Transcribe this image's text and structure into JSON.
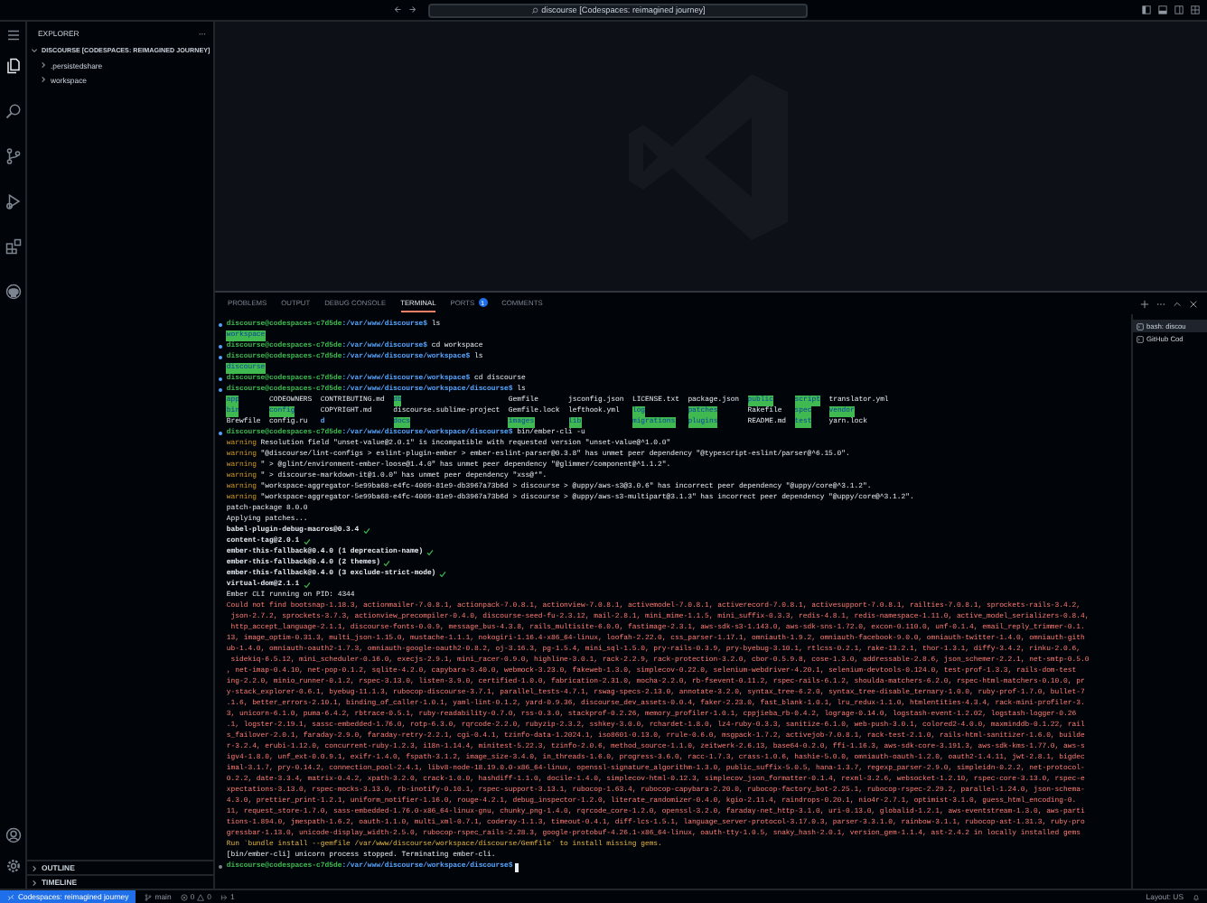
{
  "title_bar": {
    "title": "discourse [Codespaces: reimagined journey]"
  },
  "activity_bar": {
    "items": [
      {
        "selected": true
      },
      {
        "selected": false
      },
      {
        "selected": false
      },
      {
        "selected": false
      },
      {
        "selected": false
      },
      {
        "selected": false
      }
    ]
  },
  "sidebar": {
    "title": "EXPLORER",
    "more": "···",
    "tree": {
      "label": "DISCOURSE [CODESPACES: REIMAGINED JOURNEY]",
      "expanded": true,
      "children": [
        {
          "label": ".persistedshare",
          "expanded": false
        },
        {
          "label": "workspace",
          "expanded": false
        }
      ]
    },
    "sections": [
      {
        "label": "OUTLINE",
        "expanded": false
      },
      {
        "label": "TIMELINE",
        "expanded": false
      }
    ]
  },
  "panel": {
    "tabs": [
      {
        "label": "PROBLEMS",
        "selected": false
      },
      {
        "label": "OUTPUT",
        "selected": false
      },
      {
        "label": "DEBUG CONSOLE",
        "selected": false
      },
      {
        "label": "TERMINAL",
        "selected": true
      },
      {
        "label": "PORTS",
        "selected": false,
        "badge": "1"
      },
      {
        "label": "COMMENTS",
        "selected": false
      }
    ],
    "terminals": [
      {
        "label": "bash: discou",
        "selected": true
      },
      {
        "label": "GitHub Cod",
        "selected": false
      }
    ]
  },
  "terminal": {
    "lines": [
      {
        "kind": "prompt",
        "completed": true,
        "cursor": false,
        "user": "discourse@codespaces-c7d5de",
        "path": ":/var/www/discourse$",
        "command": "ls"
      },
      {
        "kind": "listing",
        "columns": [
          [
            {
              "name": "workspace",
              "kind": "other_writable"
            }
          ]
        ]
      },
      {
        "kind": "prompt",
        "completed": true,
        "cursor": false,
        "user": "discourse@codespaces-c7d5de",
        "path": ":/var/www/discourse$",
        "command": "cd workspace"
      },
      {
        "kind": "prompt",
        "completed": true,
        "cursor": false,
        "user": "discourse@codespaces-c7d5de",
        "path": ":/var/www/discourse/workspace$",
        "command": "ls"
      },
      {
        "kind": "listing",
        "columns": [
          [
            {
              "name": "discourse",
              "kind": "other_writable"
            }
          ]
        ]
      },
      {
        "kind": "prompt",
        "completed": true,
        "cursor": false,
        "user": "discourse@codespaces-c7d5de",
        "path": ":/var/www/discourse/workspace$",
        "command": "cd discourse"
      },
      {
        "kind": "prompt",
        "completed": true,
        "cursor": false,
        "user": "discourse@codespaces-c7d5de",
        "path": ":/var/www/discourse/workspace/discourse$",
        "command": "ls"
      },
      {
        "kind": "listing",
        "columns": [
          [
            {
              "name": "app",
              "kind": "other_writable"
            },
            {
              "name": "bin",
              "kind": "other_writable"
            },
            {
              "name": "Brewfile",
              "kind": "file"
            }
          ],
          [
            {
              "name": "CODEOWNERS",
              "kind": "file"
            },
            {
              "name": "config",
              "kind": "other_writable"
            },
            {
              "name": "config.ru",
              "kind": "file"
            }
          ],
          [
            {
              "name": "CONTRIBUTING.md",
              "kind": "file"
            },
            {
              "name": "COPYRIGHT.md",
              "kind": "file"
            },
            {
              "name": "d",
              "kind": "dir"
            }
          ],
          [
            {
              "name": "db",
              "kind": "other_writable"
            },
            {
              "name": "discourse.sublime-project",
              "kind": "file"
            },
            {
              "name": "docs",
              "kind": "other_writable"
            }
          ],
          [
            {
              "name": "Gemfile",
              "kind": "file"
            },
            {
              "name": "Gemfile.lock",
              "kind": "file"
            },
            {
              "name": "images",
              "kind": "other_writable"
            }
          ],
          [
            {
              "name": "jsconfig.json",
              "kind": "file"
            },
            {
              "name": "lefthook.yml",
              "kind": "file"
            },
            {
              "name": "lib",
              "kind": "other_writable"
            }
          ],
          [
            {
              "name": "LICENSE.txt",
              "kind": "file"
            },
            {
              "name": "log",
              "kind": "other_writable"
            },
            {
              "name": "migrations",
              "kind": "other_writable"
            }
          ],
          [
            {
              "name": "package.json",
              "kind": "file"
            },
            {
              "name": "patches",
              "kind": "other_writable"
            },
            {
              "name": "plugins",
              "kind": "other_writable"
            }
          ],
          [
            {
              "name": "public",
              "kind": "other_writable"
            },
            {
              "name": "Rakefile",
              "kind": "file"
            },
            {
              "name": "README.md",
              "kind": "file"
            }
          ],
          [
            {
              "name": "script",
              "kind": "other_writable"
            },
            {
              "name": "spec",
              "kind": "other_writable"
            },
            {
              "name": "test",
              "kind": "other_writable"
            }
          ],
          [
            {
              "name": "translator.yml",
              "kind": "file"
            },
            {
              "name": "vendor",
              "kind": "other_writable"
            },
            {
              "name": "yarn.lock",
              "kind": "file"
            }
          ]
        ]
      },
      {
        "kind": "prompt",
        "completed": true,
        "cursor": false,
        "user": "discourse@codespaces-c7d5de",
        "path": ":/var/www/discourse/workspace/discourse$",
        "command": "bin/ember-cli -u"
      },
      {
        "kind": "warning",
        "label": "warning",
        "text": "Resolution field \"unset-value@2.0.1\" is incompatible with requested version \"unset-value@^1.0.0\""
      },
      {
        "kind": "warning",
        "label": "warning",
        "text": "\"@discourse/lint-configs > eslint-plugin-ember > ember-eslint-parser@0.3.8\" has unmet peer dependency \"@typescript-eslint/parser@^6.15.0\"."
      },
      {
        "kind": "warning",
        "label": "warning",
        "text": "\" > @glint/environment-ember-loose@1.4.0\" has unmet peer dependency \"@glimmer/component@^1.1.2\"."
      },
      {
        "kind": "warning",
        "label": "warning",
        "text": "\" > discourse-markdown-it@1.0.0\" has unmet peer dependency \"xss@*\"."
      },
      {
        "kind": "warning",
        "label": "warning",
        "text": "\"workspace-aggregator-5e99ba68-e4fc-4009-81e9-db3967a73b6d > discourse > @uppy/aws-s3@3.0.6\" has incorrect peer dependency \"@uppy/core@^3.1.2\"."
      },
      {
        "kind": "warning",
        "label": "warning",
        "text": "\"workspace-aggregator-5e99ba68-e4fc-4009-81e9-db3967a73b6d > discourse > @uppy/aws-s3-multipart@3.1.3\" has incorrect peer dependency \"@uppy/core@^3.1.2\"."
      },
      {
        "kind": "plain",
        "text": "patch-package 8.0.0"
      },
      {
        "kind": "plain",
        "text": "Applying patches..."
      },
      {
        "kind": "check",
        "text": "babel-plugin-debug-macros@0.3.4"
      },
      {
        "kind": "check",
        "text": "content-tag@2.0.1"
      },
      {
        "kind": "check",
        "text": "ember-this-fallback@0.4.0 (1 deprecation-name)"
      },
      {
        "kind": "check",
        "text": "ember-this-fallback@0.4.0 (2 themes)"
      },
      {
        "kind": "check",
        "text": "ember-this-fallback@0.4.0 (3 exclude-strict-mode)"
      },
      {
        "kind": "check",
        "text": "virtual-dom@2.1.1"
      },
      {
        "kind": "plain",
        "text": "Ember CLI running on PID: 4344"
      },
      {
        "kind": "error",
        "lines": [
          "Could not find bootsnap-1.18.3, actionmailer-7.0.8.1, actionpack-7.0.8.1, actionview-7.0.8.1, activemodel-7.0.8.1, activerecord-7.0.8.1, activesupport-7.0.8.1, railties-7.0.8.1, sprockets-rails-3.4.2,",
          " json-2.7.2, sprockets-3.7.3, actionview_precompiler-0.4.0, discourse-seed-fu-2.3.12, mail-2.8.1, mini_mime-1.1.5, mini_suffix-0.3.3, redis-4.8.1, redis-namespace-1.11.0, active_model_serializers-0.8.4,",
          " http_accept_language-2.1.1, discourse-fonts-0.0.9, message_bus-4.3.8, rails_multisite-6.0.0, fastimage-2.3.1, aws-sdk-s3-1.143.0, aws-sdk-sns-1.72.0, excon-0.110.0, unf-0.1.4, email_reply_trimmer-0.1.",
          "13, image_optim-0.31.3, multi_json-1.15.0, mustache-1.1.1, nokogiri-1.16.4-x86_64-linux, loofah-2.22.0, css_parser-1.17.1, omniauth-1.9.2, omniauth-facebook-9.0.0, omniauth-twitter-1.4.0, omniauth-gith",
          "ub-1.4.0, omniauth-oauth2-1.7.3, omniauth-google-oauth2-0.8.2, oj-3.16.3, pg-1.5.4, mini_sql-1.5.0, pry-rails-0.3.9, pry-byebug-3.10.1, rtlcss-0.2.1, rake-13.2.1, thor-1.3.1, diffy-3.4.2, rinku-2.0.6,",
          " sidekiq-6.5.12, mini_scheduler-0.16.0, execjs-2.9.1, mini_racer-0.9.0, highline-3.0.1, rack-2.2.9, rack-protection-3.2.0, cbor-0.5.9.8, cose-1.3.0, addressable-2.8.6, json_schemer-2.2.1, net-smtp-0.5.0",
          ", net-imap-0.4.10, net-pop-0.1.2, sqlite-4.2.0, capybara-3.40.0, webmock-3.23.0, fakeweb-1.3.0, simplecov-0.22.0, selenium-webdriver-4.20.1, selenium-devtools-0.124.0, test-prof-1.3.3, rails-dom-test",
          "ing-2.2.0, minio_runner-0.1.2, rspec-3.13.0, listen-3.9.0, certified-1.0.0, fabrication-2.31.0, mocha-2.2.0, rb-fsevent-0.11.2, rspec-rails-6.1.2, shoulda-matchers-6.2.0, rspec-html-matchers-0.10.0, pr",
          "y-stack_explorer-0.6.1, byebug-11.1.3, rubocop-discourse-3.7.1, parallel_tests-4.7.1, rswag-specs-2.13.0, annotate-3.2.0, syntax_tree-6.2.0, syntax_tree-disable_ternary-1.0.0, ruby-prof-1.7.0, bullet-7",
          ".1.6, better_errors-2.10.1, binding_of_caller-1.0.1, yaml-lint-0.1.2, yard-0.9.36, discourse_dev_assets-0.0.4, faker-2.23.0, fast_blank-1.0.1, lru_redux-1.1.0, htmlentities-4.3.4, rack-mini-profiler-3.",
          "3, unicorn-6.1.0, puma-6.4.2, rbtrace-0.5.1, ruby-readability-0.7.0, rss-0.3.0, stackprof-0.2.26, memory_profiler-1.0.1, cppjieba_rb-0.4.2, lograge-0.14.0, logstash-event-1.2.02, logstash-logger-0.26",
          ".1, logster-2.19.1, sassc-embedded-1.76.0, rotp-6.3.0, rqrcode-2.2.0, rubyzip-2.3.2, sshkey-3.0.0, rchardet-1.8.0, lz4-ruby-0.3.3, sanitize-6.1.0, web-push-3.0.1, colored2-4.0.0, maxminddb-0.1.22, rail",
          "s_failover-2.0.1, faraday-2.9.0, faraday-retry-2.2.1, cgi-0.4.1, tzinfo-data-1.2024.1, iso8601-0.13.0, rrule-0.6.0, msgpack-1.7.2, activejob-7.0.8.1, rack-test-2.1.0, rails-html-sanitizer-1.6.0, builde",
          "r-3.2.4, erubi-1.12.0, concurrent-ruby-1.2.3, i18n-1.14.4, minitest-5.22.3, tzinfo-2.0.6, method_source-1.1.0, zeitwerk-2.6.13, base64-0.2.0, ffi-1.16.3, aws-sdk-core-3.191.3, aws-sdk-kms-1.77.0, aws-s",
          "igv4-1.8.0, unf_ext-0.0.9.1, exifr-1.4.0, fspath-3.1.2, image_size-3.4.0, in_threads-1.6.0, progress-3.6.0, racc-1.7.3, crass-1.0.6, hashie-5.0.0, omniauth-oauth-1.2.0, oauth2-1.4.11, jwt-2.8.1, bigdec",
          "imal-3.1.7, pry-0.14.2, connection_pool-2.4.1, libv8-node-18.19.0.0-x86_64-linux, openssl-signature_algorithm-1.3.0, public_suffix-5.0.5, hana-1.3.7, regexp_parser-2.9.0, simpleidn-0.2.2, net-protocol-",
          "0.2.2, date-3.3.4, matrix-0.4.2, xpath-3.2.0, crack-1.0.0, hashdiff-1.1.0, docile-1.4.0, simplecov-html-0.12.3, simplecov_json_formatter-0.1.4, rexml-3.2.6, websocket-1.2.10, rspec-core-3.13.0, rspec-e",
          "xpectations-3.13.0, rspec-mocks-3.13.0, rb-inotify-0.10.1, rspec-support-3.13.1, rubocop-1.63.4, rubocop-capybara-2.20.0, rubocop-factory_bot-2.25.1, rubocop-rspec-2.29.2, parallel-1.24.0, json-schema-",
          "4.3.0, prettier_print-1.2.1, uniform_notifier-1.16.0, rouge-4.2.1, debug_inspector-1.2.0, literate_randomizer-0.4.0, kgio-2.11.4, raindrops-0.20.1, nio4r-2.7.1, optimist-3.1.0, guess_html_encoding-0.",
          "11, request_store-1.7.0, sass-embedded-1.76.0-x86_64-linux-gnu, chunky_png-1.4.0, rqrcode_core-1.2.0, openssl-3.2.0, faraday-net_http-3.1.0, uri-0.13.0, globalid-1.2.1, aws-eventstream-1.3.0, aws-parti",
          "tions-1.894.0, jmespath-1.6.2, oauth-1.1.0, multi_xml-0.7.1, coderay-1.1.3, timeout-0.4.1, diff-lcs-1.5.1, language_server-protocol-3.17.0.3, parser-3.3.1.0, rainbow-3.1.1, rubocop-ast-1.31.3, ruby-pro",
          "gressbar-1.13.0, unicode-display_width-2.5.0, rubocop-rspec_rails-2.28.3, google-protobuf-4.26.1-x86_64-linux, oauth-tty-1.0.5, snaky_hash-2.0.1, version_gem-1.1.4, ast-2.4.2 in locally installed gems"
        ]
      },
      {
        "kind": "notice",
        "text": "Run `bundle install --gemfile /var/www/discourse/workspace/discourse/Gemfile` to install missing gems."
      },
      {
        "kind": "plain",
        "text": "[bin/ember-cli] unicorn process stopped. Terminating ember-cli."
      },
      {
        "kind": "prompt",
        "completed": false,
        "cursor": true,
        "user": "discourse@codespaces-c7d5de",
        "path": ":/var/www/discourse/workspace/discourse$"
      }
    ]
  },
  "status_bar": {
    "remote": "Codespaces: reimagined journey",
    "branch": "main",
    "errors": "0",
    "warnings": "0",
    "ports": "1",
    "layout": "Layout: US"
  }
}
